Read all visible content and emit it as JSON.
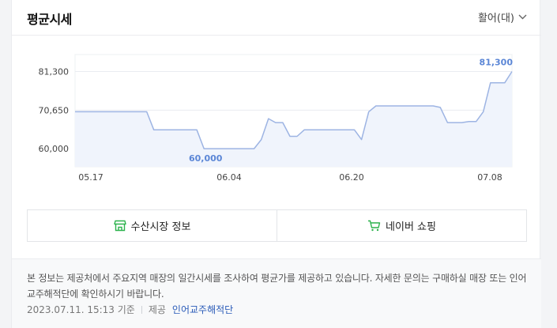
{
  "panel": {
    "title": "평균시세",
    "unit_label": "활어(대)"
  },
  "chart_data": {
    "type": "area",
    "title": "",
    "xlabel": "",
    "ylabel": "",
    "x_ticks": [
      "05.17",
      "06.04",
      "06.20",
      "07.08"
    ],
    "y_ticks": [
      "81,300",
      "70,650",
      "60,000"
    ],
    "ylim": [
      55000,
      86000
    ],
    "grid": true,
    "series": [
      {
        "values": [
          70200,
          70200,
          70200,
          70200,
          70200,
          70200,
          70200,
          70200,
          70200,
          70200,
          70200,
          65200,
          65200,
          65200,
          65200,
          65200,
          65200,
          65200,
          60000,
          60000,
          60000,
          60000,
          60000,
          60000,
          60000,
          60000,
          62500,
          68300,
          67200,
          67200,
          63400,
          63400,
          65200,
          65200,
          65200,
          65200,
          65200,
          65200,
          65200,
          65200,
          62500,
          70200,
          71800,
          71800,
          71800,
          71800,
          71800,
          71800,
          71800,
          71800,
          71800,
          71400,
          67200,
          67200,
          67200,
          67500,
          67500,
          70200,
          78200,
          78200,
          78200,
          81300
        ]
      }
    ],
    "annotations": {
      "max_label": "81,300",
      "min_label": "60,000"
    }
  },
  "colors": {
    "line": "#9db4e3",
    "fill": "#f0f4fc",
    "label": "#5b86d6",
    "green": "#2bb24c"
  },
  "links": [
    {
      "label": "수산시장 정보",
      "icon": "store-icon"
    },
    {
      "label": "네이버 쇼핑",
      "icon": "cart-icon"
    }
  ],
  "footer": {
    "description": "본 정보는 제공처에서 주요지역 매장의 일간시세를 조사하여 평균가를 제공하고 있습니다. 자세한 문의는 구매하실 매장 또는 인어교주해적단에 확인하시기 바랍니다.",
    "timestamp": "2023.07.11. 15:13 기준",
    "provider_prefix": "제공",
    "provider": "인어교주해적단"
  }
}
